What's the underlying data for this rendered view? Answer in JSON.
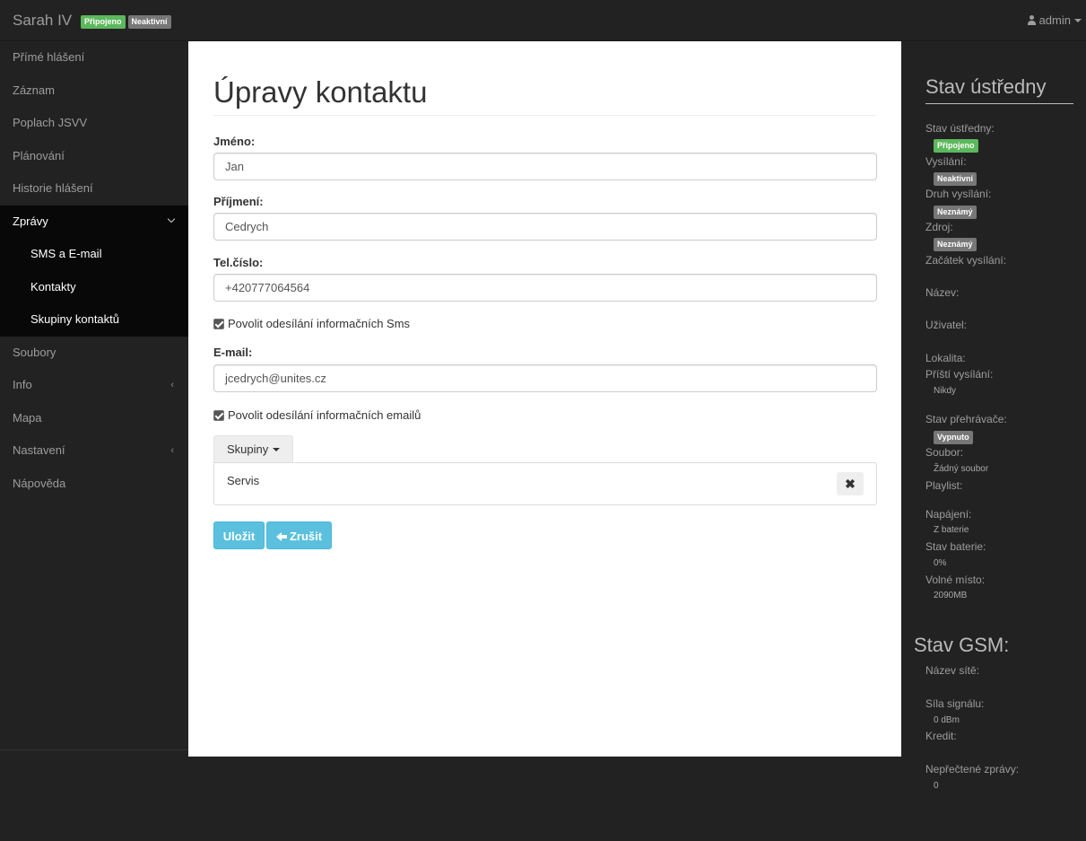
{
  "navbar": {
    "brand": "Sarah IV",
    "badge_connected": "Připojeno",
    "badge_inactive": "Neaktivní",
    "user": "admin",
    "user_icon": "user-icon"
  },
  "sidebar": {
    "items": [
      {
        "label": "Přímé hlášení"
      },
      {
        "label": "Záznam"
      },
      {
        "label": "Poplach JSVV"
      },
      {
        "label": "Plánování"
      },
      {
        "label": "Historie hlášení"
      },
      {
        "label": "Zprávy"
      },
      {
        "label": "Soubory"
      },
      {
        "label": "Info"
      },
      {
        "label": "Mapa"
      },
      {
        "label": "Nastavení"
      },
      {
        "label": "Nápověda"
      }
    ],
    "sub_items": [
      {
        "label": "SMS a E-mail"
      },
      {
        "label": "Kontakty"
      },
      {
        "label": "Skupiny kontaktů"
      }
    ]
  },
  "form": {
    "title": "Úpravy kontaktu",
    "first_name_label": "Jméno:",
    "first_name_value": "Jan",
    "last_name_label": "Příjmení:",
    "last_name_value": "Cedrych",
    "phone_label": "Tel.číslo:",
    "phone_value": "+420777064564",
    "sms_checkbox_label": "Povolit odesílání informačních Sms",
    "email_label": "E-mail:",
    "email_value": "jcedrych@unites.cz",
    "email_checkbox_label": "Povolit odesílání informačních emailů",
    "groups_button": "Skupiny",
    "groups": [
      "Servis"
    ],
    "remove_symbol": "✖",
    "save_button": "Uložit",
    "cancel_button": "Zrušit"
  },
  "status": {
    "title": "Stav ústředny",
    "central_state_label": "Stav ústředny:",
    "central_state_badge": "Připojeno",
    "broadcast_label": "Vysílání:",
    "broadcast_badge": "Neaktivní",
    "broadcast_type_label": "Druh vysílání:",
    "broadcast_type_badge": "Neznámý",
    "source_label": "Zdroj:",
    "source_badge": "Neznámý",
    "broadcast_start_label": "Začátek vysílání:",
    "name_label": "Název:",
    "user_label": "Uživatel:",
    "locality_label": "Lokalita:",
    "next_broadcast_label": "Příští vysílání:",
    "next_broadcast_value": "Nikdy",
    "player_state_label": "Stav přehrávače:",
    "player_state_badge": "Vypnuto",
    "file_label": "Soubor:",
    "file_value": "Žádný soubor",
    "playlist_label": "Playlist:",
    "power_label": "Napájení:",
    "power_value": "Z baterie",
    "battery_label": "Stav baterie:",
    "battery_value": "0%",
    "free_space_label": "Volné místo:",
    "free_space_value": "2090MB",
    "gsm_title": "Stav GSM:",
    "network_label": "Název sítě:",
    "signal_label": "Síla signálu:",
    "signal_value": "0 dBm",
    "credit_label": "Kredit:",
    "unread_label": "Nepřečtené zprávy:",
    "unread_value": "0"
  },
  "colors": {
    "dark_bg": "#222222",
    "active_bg": "#080808",
    "success": "#5cb85c",
    "default_badge": "#777777",
    "info_button": "#5bc0de"
  }
}
